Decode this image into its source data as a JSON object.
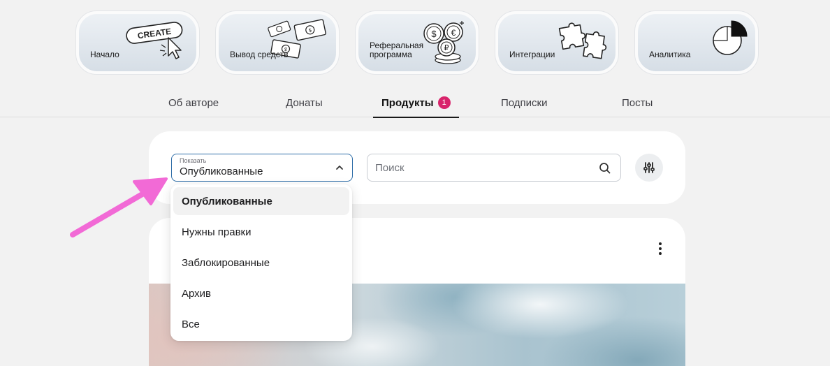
{
  "cards": [
    {
      "label": "Начало",
      "icon": "create-cursor-icon",
      "art_text": "CREATE"
    },
    {
      "label": "Вывод средств",
      "icon": "money-bills-icon"
    },
    {
      "label": "Реферальная\nпрограмма",
      "icon": "coins-icon"
    },
    {
      "label": "Интеграции",
      "icon": "puzzle-icon"
    },
    {
      "label": "Аналитика",
      "icon": "pie-chart-icon"
    }
  ],
  "tabs": [
    {
      "label": "Об авторе"
    },
    {
      "label": "Донаты"
    },
    {
      "label": "Продукты",
      "badge": "1",
      "active": true
    },
    {
      "label": "Подписки"
    },
    {
      "label": "Посты"
    }
  ],
  "filter": {
    "caption": "Показать",
    "selected": "Опубликованные",
    "options": [
      "Опубликованные",
      "Нужны правки",
      "Заблокированные",
      "Архив",
      "Все"
    ]
  },
  "search": {
    "placeholder": "Поиск",
    "value": ""
  },
  "colors": {
    "accent": "#2f6ea8",
    "badge": "#d8246b",
    "annotation_arrow": "#f26ad6"
  }
}
